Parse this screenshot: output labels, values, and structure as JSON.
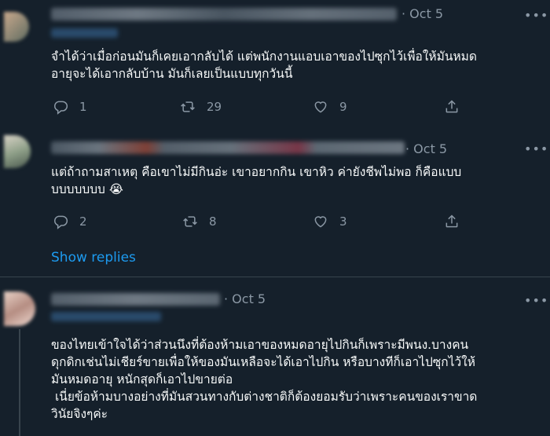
{
  "tweets": [
    {
      "date": "· Oct 5",
      "text": "จำได้ว่าเมื่อก่อนมันก็เคยเอากลับได้ แต่พนักงานแอบเอาของไปซุกไว้เพื่อให้มันหมด\nอายุจะได้เอากลับบ้าน มันก็เลยเป็นแบบทุกวันนี้",
      "reply_count": "1",
      "retweet_count": "29",
      "like_count": "9"
    },
    {
      "date": "· Oct 5",
      "text": "แต่ถ้าถามสาเหตุ คือเขาไม่มีกินอ่ะ เขาอยากกิน เขาหิว ค่ายังชีพไม่พอ ก็คือแบบ\nบบบบบบบ 😭",
      "reply_count": "2",
      "retweet_count": "8",
      "like_count": "3"
    },
    {
      "date": "· Oct 5",
      "text": "ของไทยเข้าใจได้ว่าส่วนนึงที่ต้องห้ามเอาของหมดอายุไปกินก็เพราะมีพนง.บางคน\nดุกดิกเช่นไม่เชียร์ขายเพื่อให้ของมันเหลือจะได้เอาไปกิน หรือบางทีก็เอาไปซุกไว้ให้\nมันหมดอายุ หนักสุดก็เอาไปขายต่อ\n เนี่ยข้อห้ามบางอย่างที่มันสวนทางกับต่างชาติก็ต้องยอมรับว่าเพราะคนของเราขาด\nวินัยจิงๆค่ะ"
    }
  ],
  "show_replies": "Show replies",
  "more_icon": "•••",
  "colors": {
    "background": "#15202b",
    "text": "#f7f9f9",
    "secondary": "#8b98a5",
    "accent": "#1d9bf0"
  },
  "icons": [
    "reply-icon",
    "retweet-icon",
    "like-icon",
    "share-icon",
    "more-icon"
  ]
}
